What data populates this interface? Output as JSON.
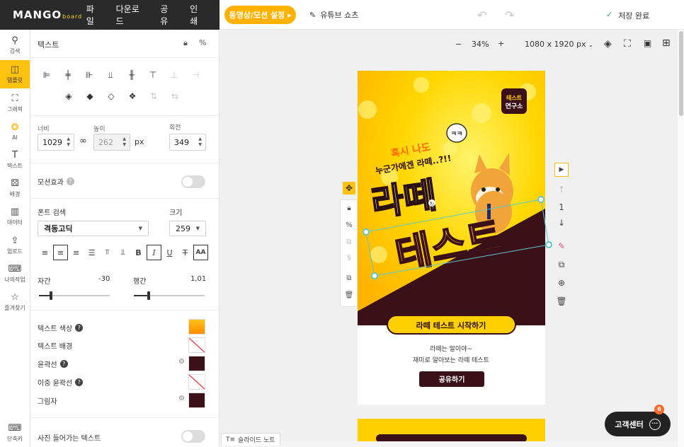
{
  "brand": {
    "logo_main": "MANGO",
    "logo_sub": "board"
  },
  "menu": {
    "file": "파일",
    "download": "다운로드",
    "share": "공유",
    "print": "인쇄"
  },
  "toolbar": {
    "motion_button": "동영상/모션 설정 ▸",
    "shorts_button": "유튜브 쇼츠",
    "save_status": "저장 완료"
  },
  "nav": [
    {
      "label": "검색",
      "icon": "search-icon"
    },
    {
      "label": "템플릿",
      "icon": "template-icon"
    },
    {
      "label": "그래픽",
      "icon": "graphic-icon"
    },
    {
      "label": "AI",
      "icon": "ai-icon"
    },
    {
      "label": "텍스트",
      "icon": "text-icon"
    },
    {
      "label": "배경",
      "icon": "background-icon"
    },
    {
      "label": "데이터",
      "icon": "data-icon"
    },
    {
      "label": "업로드",
      "icon": "upload-icon"
    },
    {
      "label": "나의작업",
      "icon": "my-work-icon"
    },
    {
      "label": "즐겨찾기",
      "icon": "star-icon"
    },
    {
      "label": "단축키",
      "icon": "keyboard-icon"
    }
  ],
  "panel": {
    "title": "텍스트",
    "width_label": "너비",
    "width_value": "1029",
    "height_label": "높이",
    "height_value": "262",
    "unit": "px",
    "rotate_label": "회전",
    "rotate_value": "349",
    "motion_label": "모션효과",
    "font_search_label": "폰트 검색",
    "font_name": "격동고딕",
    "size_label": "크기",
    "size_value": "259",
    "spacing_label": "자간",
    "spacing_value": "-30",
    "lineheight_label": "행간",
    "lineheight_value": "1,01",
    "text_color_label": "텍스트 색상",
    "text_bg_label": "텍스트 배경",
    "outline_label": "윤곽선",
    "double_outline_label": "이중 윤곽선",
    "shadow_label": "그림자",
    "photo_text_label": "사진 들어가는 텍스트",
    "colors": {
      "text": "#ffa200",
      "outline": "#3a1118",
      "shadow": "#3a1118"
    }
  },
  "canvas": {
    "zoom": "34%",
    "size_select": "1080 x 1920 px",
    "page_number": "1",
    "slide_note": "슬라이드 노트"
  },
  "artwork": {
    "badge_top": "테스트",
    "badge_bottom": "연구소",
    "bubble": "ㅋㅋ",
    "line1": "혹시 나도",
    "line2": "누군가에겐 라떼..?!!",
    "title1": "라떼",
    "title2": "테스트",
    "cta": "라떼 테스트 시작하기",
    "desc1": "라떼는 말이야~",
    "desc2": "재미로 알아보는 라떼 테스트",
    "share": "공유하기"
  },
  "help": {
    "label": "고객센터",
    "badge": "6"
  }
}
